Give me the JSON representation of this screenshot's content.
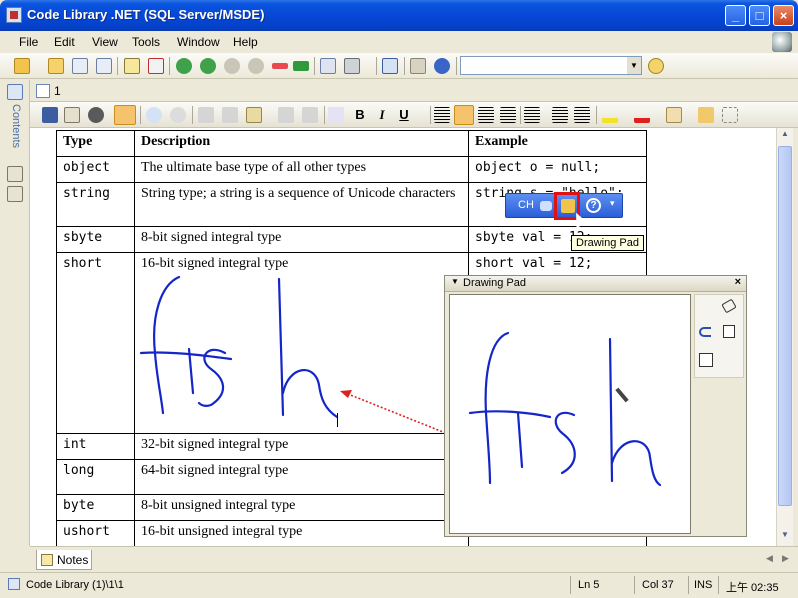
{
  "window": {
    "title": "Code Library .NET (SQL Server/MSDE)",
    "min": "_",
    "max": "□",
    "close": "×"
  },
  "menu": [
    "File",
    "Edit",
    "View",
    "Tools",
    "Window",
    "Help"
  ],
  "sidebar": {
    "contents_label": "Contents"
  },
  "doc_tab": {
    "number": "1"
  },
  "table": {
    "headers": [
      "Type",
      "Description",
      "Example"
    ],
    "rows": [
      {
        "type": "object",
        "description": "The ultimate base type of all other types",
        "example": "object o = null;"
      },
      {
        "type": "string",
        "description": "String type; a string is a sequence of Unicode characters",
        "example": "string s = \"hello\";"
      },
      {
        "type": "sbyte",
        "description": "8-bit signed integral type",
        "example": "sbyte val = 12;"
      },
      {
        "type": "short",
        "description": "16-bit signed integral type",
        "example": "short val = 12;"
      },
      {
        "type": "int",
        "description": "32-bit signed integral type",
        "example": ""
      },
      {
        "type": "long",
        "description": "64-bit signed integral type",
        "example": ""
      },
      {
        "type": "byte",
        "description": "8-bit unsigned integral type",
        "example": ""
      },
      {
        "type": "ushort",
        "description": "16-bit unsigned integral type",
        "example": ""
      }
    ]
  },
  "ime_bar": {
    "lang": "CH"
  },
  "tooltip": "Drawing Pad",
  "drawing_pad": {
    "title": "Drawing Pad",
    "close": "×"
  },
  "bottom_tab": {
    "label": "Notes"
  },
  "status": {
    "path": "Code Library (1)\\1\\1",
    "line": "Ln 5",
    "col": "Col 37",
    "mode": "INS",
    "time": "上午 02:35"
  },
  "colors": {
    "title_blue": "#0648d6",
    "highlight_orange": "#f5c36b",
    "ink": "#1426c8",
    "arrow_red": "#e02020"
  }
}
